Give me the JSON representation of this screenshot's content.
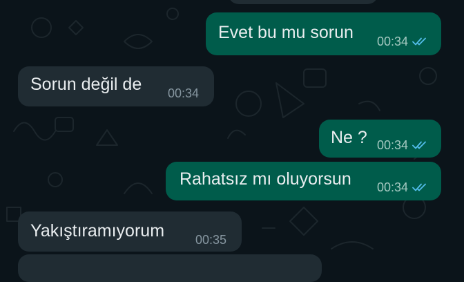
{
  "messages": [
    {
      "direction": "outgoing",
      "text": "Evet bu mu sorun",
      "time": "00:34",
      "status_icon": "double-check-read-icon"
    },
    {
      "direction": "incoming",
      "text": "Sorun değil de",
      "time": "00:34"
    },
    {
      "direction": "outgoing",
      "text": "Ne ?",
      "time": "00:34",
      "status_icon": "double-check-read-icon"
    },
    {
      "direction": "outgoing",
      "text": "Rahatsız mı oluyorsun",
      "time": "00:34",
      "status_icon": "double-check-read-icon"
    },
    {
      "direction": "incoming",
      "text": "Yakıştıramıyorum",
      "time": "00:35"
    }
  ],
  "colors": {
    "background": "#0b141a",
    "outgoing_bubble": "#005c4b",
    "incoming_bubble": "#202c33",
    "text": "#e9edef",
    "read_tick": "#53bdeb"
  }
}
